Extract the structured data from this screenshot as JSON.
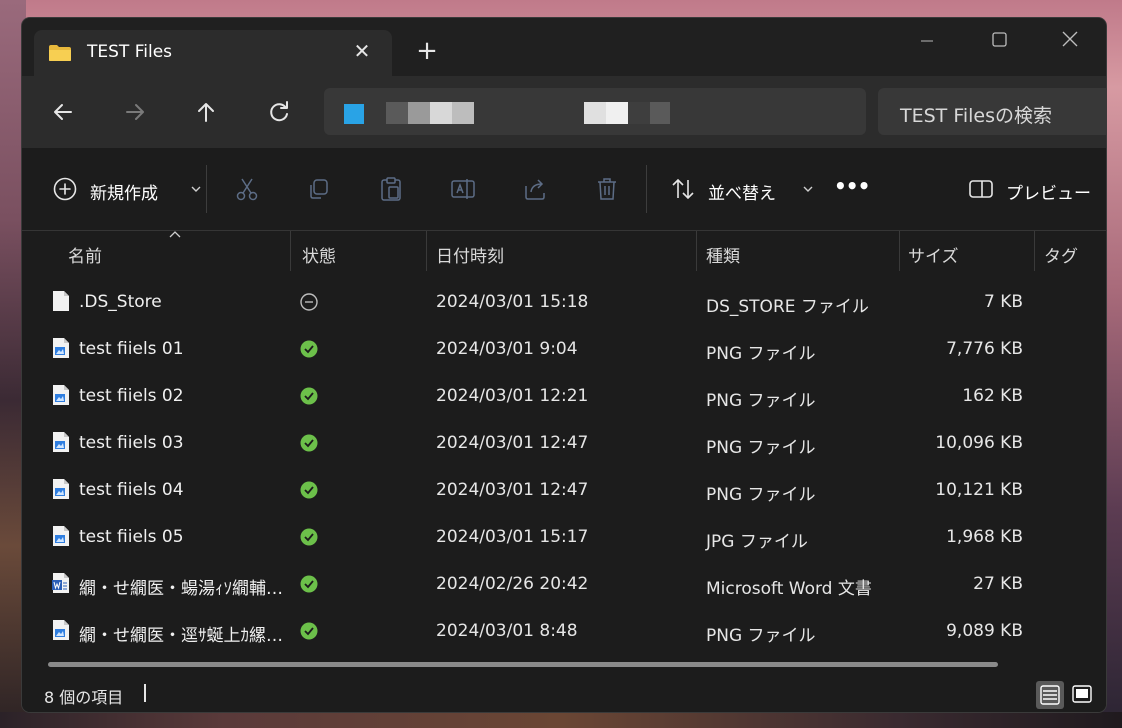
{
  "tab": {
    "title": "TEST Files",
    "close_symbol": "✕",
    "new_tab_symbol": "+"
  },
  "search": {
    "placeholder": "TEST Filesの検索"
  },
  "toolbar": {
    "new_label": "新規作成",
    "sort_label": "並べ替え",
    "more_label": "•••",
    "preview_label": "プレビュー"
  },
  "columns": {
    "name": "名前",
    "status": "状態",
    "date": "日付時刻",
    "type": "種類",
    "size": "サイズ",
    "tags": "タグ"
  },
  "files": [
    {
      "name": ".DS_Store",
      "status": "unsynced",
      "date": "2024/03/01 15:18",
      "type": "DS_STORE ファイル",
      "size": "7 KB",
      "icon": "blank-file-icon"
    },
    {
      "name": "test fiiels 01",
      "status": "synced",
      "date": "2024/03/01 9:04",
      "type": "PNG ファイル",
      "size": "7,776 KB",
      "icon": "image-file-icon"
    },
    {
      "name": "test fiiels 02",
      "status": "synced",
      "date": "2024/03/01 12:21",
      "type": "PNG ファイル",
      "size": "162 KB",
      "icon": "image-file-icon"
    },
    {
      "name": "test fiiels 03",
      "status": "synced",
      "date": "2024/03/01 12:47",
      "type": "PNG ファイル",
      "size": "10,096 KB",
      "icon": "image-file-icon"
    },
    {
      "name": "test fiiels 04",
      "status": "synced",
      "date": "2024/03/01 12:47",
      "type": "PNG ファイル",
      "size": "10,121 KB",
      "icon": "image-file-icon"
    },
    {
      "name": "test fiiels 05",
      "status": "synced",
      "date": "2024/03/01 15:17",
      "type": "JPG ファイル",
      "size": "1,968 KB",
      "icon": "image-file-icon"
    },
    {
      "name": "繝・せ繝医・蝪湯ｨｿ繝輔い...",
      "status": "synced",
      "date": "2024/02/26 20:42",
      "type": "Microsoft Word 文書",
      "size": "27 KB",
      "icon": "word-file-icon"
    },
    {
      "name": "繝・せ繝医・逕ｻ蜒上ｶ縲｡...",
      "status": "synced",
      "date": "2024/03/01 8:48",
      "type": "PNG ファイル",
      "size": "9,089 KB",
      "icon": "image-file-icon"
    }
  ],
  "statusbar": {
    "count_text": "8 個の項目"
  },
  "colors": {
    "accent": "#29a3e6",
    "synced": "#6cc04a",
    "window_bg": "#1c1c1c",
    "nav_bg": "#2c2c2c"
  }
}
